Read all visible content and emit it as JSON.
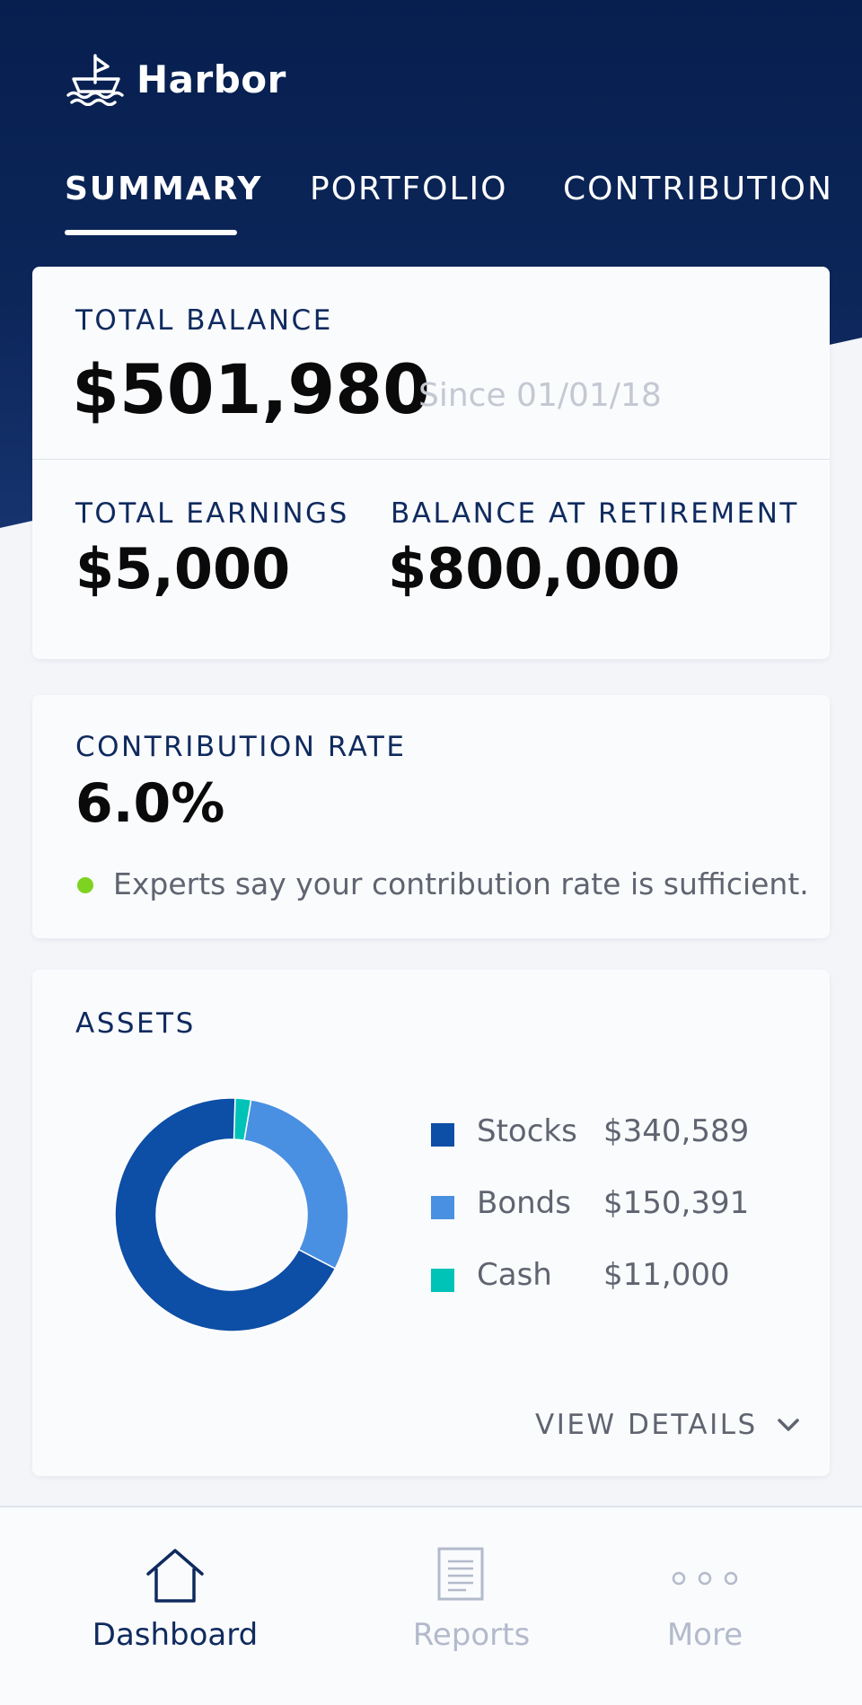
{
  "app": {
    "name": "Harbor"
  },
  "tabs": [
    "SUMMARY",
    "PORTFOLIO",
    "CONTRIBUTION"
  ],
  "balance": {
    "label": "TOTAL BALANCE",
    "value": "$501,980",
    "since": "Since 01/01/18",
    "earnings_label": "TOTAL EARNINGS",
    "earnings_value": "$5,000",
    "retirement_label": "BALANCE AT RETIREMENT",
    "retirement_value": "$800,000"
  },
  "contribution": {
    "label": "CONTRIBUTION RATE",
    "value": "6.0%",
    "status": "Experts say your contribution rate is sufficient.",
    "status_color": "#7ed321"
  },
  "assets": {
    "label": "ASSETS",
    "view_details": "VIEW DETAILS",
    "items": [
      {
        "name": "Stocks",
        "amount": "$340,589",
        "color": "#0d4ea6"
      },
      {
        "name": "Bonds",
        "amount": "$150,391",
        "color": "#4a90e2"
      },
      {
        "name": "Cash",
        "amount": "$11,000",
        "color": "#00c3b8"
      }
    ]
  },
  "chart_data": {
    "type": "pie",
    "categories": [
      "Stocks",
      "Bonds",
      "Cash"
    ],
    "values": [
      340589,
      150391,
      11000
    ]
  },
  "nav": {
    "items": [
      {
        "label": "Dashboard",
        "icon": "home-icon",
        "active": true
      },
      {
        "label": "Reports",
        "icon": "document-icon",
        "active": false
      },
      {
        "label": "More",
        "icon": "more-icon",
        "active": false
      }
    ]
  },
  "colors": {
    "header_navy": "#0a2356",
    "accent_navy": "#0f2a5e",
    "nav_inactive": "#b3bacb"
  }
}
